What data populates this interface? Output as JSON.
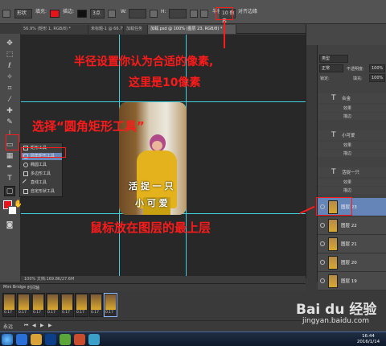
{
  "options_bar": {
    "mode": "形状",
    "fill_label": "填充:",
    "stroke_label": "描边:",
    "stroke_width": "3点",
    "w_label": "W:",
    "h_label": "H:",
    "radius_label": "半径:",
    "radius_value": "10 像素",
    "align_edges": "对齐边缘",
    "fill_color": "#e8141c",
    "stroke_color": "#111111"
  },
  "tabs": [
    {
      "label": "56.9% (矩形 1, RGB/8) *"
    },
    {
      "label": "未标题-1 @ 66.7%"
    },
    {
      "label": "加载任务"
    },
    {
      "label": "加载.psd @ 100% (图层 23, RGB/8) *"
    }
  ],
  "flyout": {
    "items": [
      {
        "label": "矩形工具",
        "shortcut": "U"
      },
      {
        "label": "圆角矩形工具",
        "shortcut": "U"
      },
      {
        "label": "椭圆工具",
        "shortcut": "U"
      },
      {
        "label": "多边形工具",
        "shortcut": "U"
      },
      {
        "label": "直线工具",
        "shortcut": "U"
      },
      {
        "label": "自定形状工具",
        "shortcut": "U"
      }
    ]
  },
  "status_bar": {
    "text": "100%   文档:169.8K/27.6M"
  },
  "photo_text": {
    "line1": "活 捉 一 只",
    "line2": "小 可 爱"
  },
  "layers": {
    "kind_label": "类型",
    "blend_mode": "正常",
    "opacity_label": "不透明度:",
    "opacity_value": "100%",
    "lock_label": "锁定:",
    "fill_label": "填充:",
    "fill_value": "100%",
    "text_layers": [
      {
        "name": "合金",
        "effects": "效果",
        "sub": "描边"
      },
      {
        "name": "小可爱",
        "effects": "效果",
        "sub": "描边"
      },
      {
        "name": "活捉一只",
        "effects": "效果",
        "sub": "描边"
      }
    ],
    "image_layers": [
      {
        "name": "图层 23",
        "selected": true
      },
      {
        "name": "图层 22",
        "selected": false
      },
      {
        "name": "图层 21",
        "selected": false
      },
      {
        "name": "图层 20",
        "selected": false
      },
      {
        "name": "图层 19",
        "selected": false
      },
      {
        "name": "图层 18",
        "selected": false
      }
    ]
  },
  "film_header": {
    "tab1": "Mini Bridge",
    "tab2": "时间轴"
  },
  "frames": [
    {
      "time": "0.17"
    },
    {
      "time": "0.17"
    },
    {
      "time": "0.17"
    },
    {
      "time": "0.17"
    },
    {
      "time": "0.17"
    },
    {
      "time": "0.17"
    },
    {
      "time": "0.17"
    },
    {
      "time": "0.17"
    }
  ],
  "film_controls": {
    "loop": "永远"
  },
  "clock": {
    "time": "16:44",
    "date": "2016/1/14"
  },
  "annotations": {
    "radius_note_line1": "半径设置你认为合适的像素,",
    "radius_note_line2": "这里是10像素",
    "tool_note": "选择“圆角矩形工具”",
    "layer_note": "鼠标放在图层的最上层"
  },
  "watermark": {
    "logo": "Bai du 经验",
    "url": "jingyan.baidu.com"
  }
}
